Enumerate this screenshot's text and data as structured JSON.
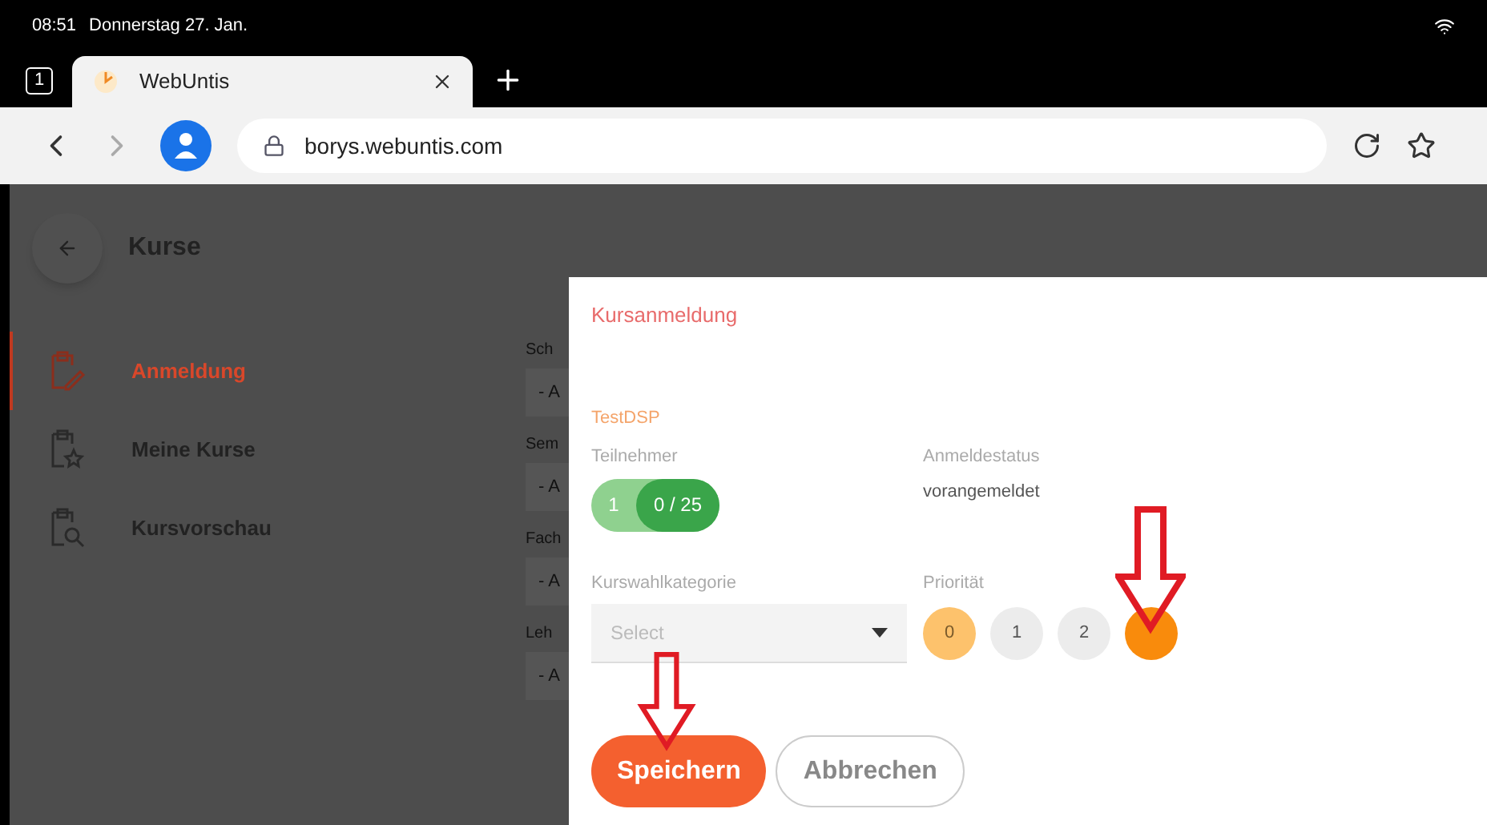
{
  "status_bar": {
    "time": "08:51",
    "date": "Donnerstag 27. Jan."
  },
  "browser": {
    "tab_count": "1",
    "tab_title": "WebUntis",
    "url": "borys.webuntis.com"
  },
  "page": {
    "title": "Kurse",
    "sidebar": [
      {
        "label": "Anmeldung",
        "selected": true
      },
      {
        "label": "Meine Kurse",
        "selected": false
      },
      {
        "label": "Kursvorschau",
        "selected": false
      }
    ],
    "filters": [
      {
        "label": "Sch",
        "value": "- A"
      },
      {
        "label": "Sem",
        "value": "- A"
      },
      {
        "label": "Fach",
        "value": "- A"
      },
      {
        "label": "Leh",
        "value": "- A"
      }
    ]
  },
  "dialog": {
    "title": "Kursanmeldung",
    "course": "TestDSP",
    "participants": {
      "label": "Teilnehmer",
      "mine": "1",
      "count": "0 / 25"
    },
    "status": {
      "label": "Anmeldestatus",
      "value": "vorangemeldet"
    },
    "category": {
      "label": "Kurswahlkategorie",
      "placeholder": "Select"
    },
    "priority": {
      "label": "Priorität",
      "options": [
        {
          "label": "0",
          "selected": false
        },
        {
          "label": "1",
          "selected": false
        },
        {
          "label": "2",
          "selected": false
        },
        {
          "selected": true
        }
      ]
    },
    "buttons": [
      {
        "label": "Speichern",
        "kind": "primary"
      },
      {
        "label": "Abbrechen",
        "kind": "secondary"
      }
    ]
  }
}
